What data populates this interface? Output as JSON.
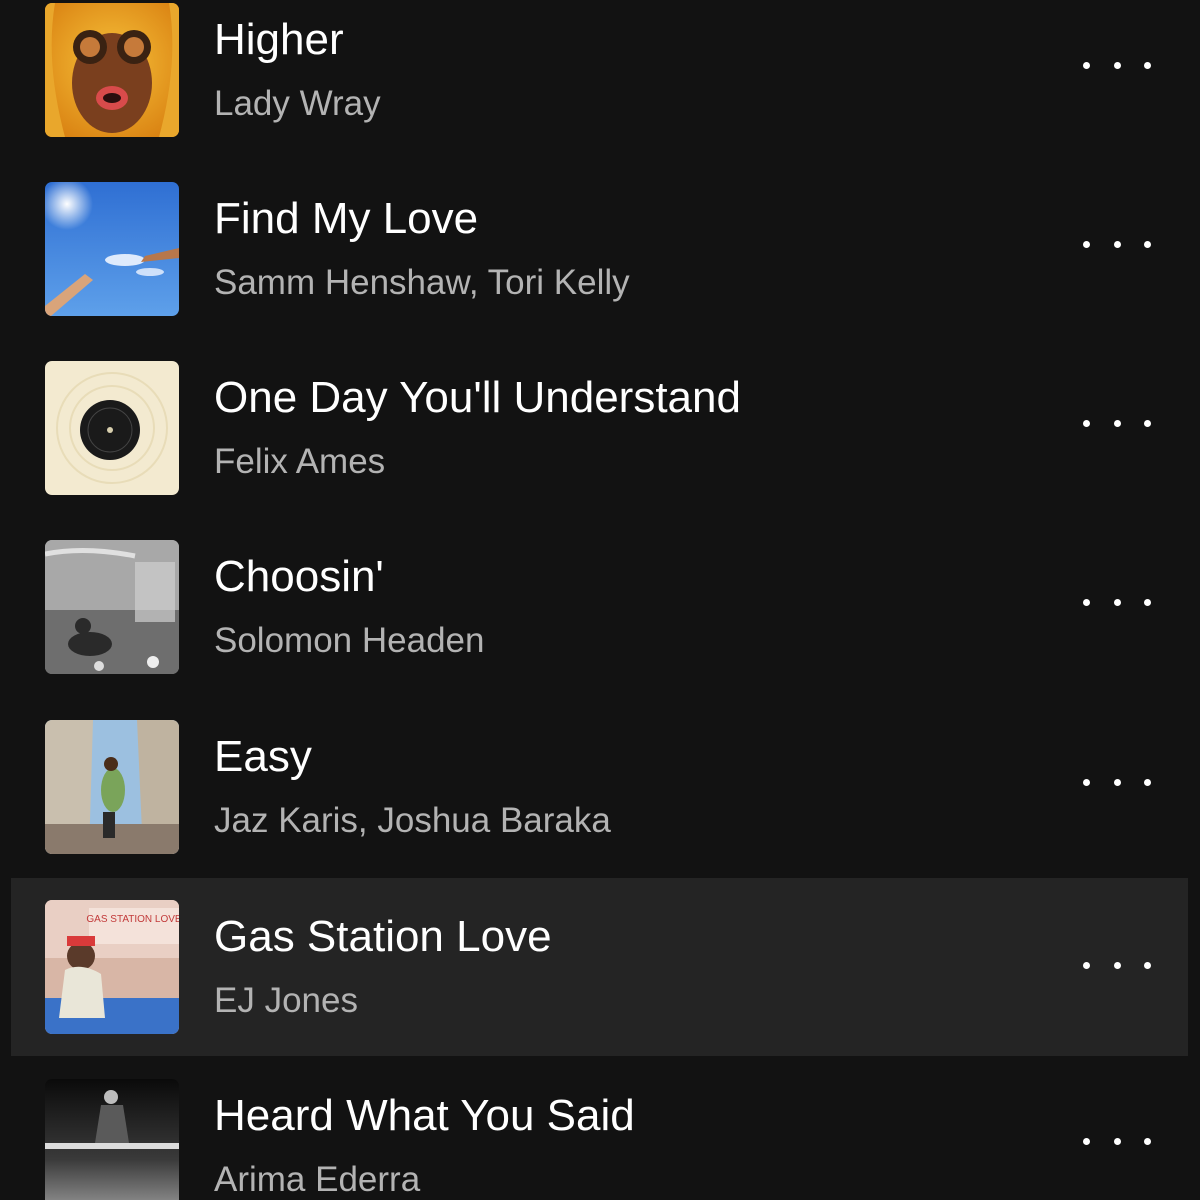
{
  "tracks": [
    {
      "title": "Higher",
      "artist": "Lady Wray",
      "active": false,
      "art": "higher-cover"
    },
    {
      "title": "Find My Love",
      "artist": "Samm Henshaw, Tori Kelly",
      "active": false,
      "art": "find-my-love-cover"
    },
    {
      "title": "One Day You'll Understand",
      "artist": "Felix Ames",
      "active": false,
      "art": "one-day-cover"
    },
    {
      "title": "Choosin'",
      "artist": "Solomon Headen",
      "active": false,
      "art": "choosin-cover"
    },
    {
      "title": "Easy",
      "artist": "Jaz Karis, Joshua Baraka",
      "active": false,
      "art": "easy-cover"
    },
    {
      "title": "Gas Station Love",
      "artist": "EJ Jones",
      "active": true,
      "art": "gas-station-love-cover",
      "art_text": "GAS STATION LOVE"
    },
    {
      "title": "Heard What You Said",
      "artist": "Arima Ederra",
      "active": false,
      "art": "heard-what-you-said-cover"
    }
  ],
  "more_icon": "more-options-icon",
  "colors": {
    "background": "#121212",
    "active_row": "#242424",
    "title": "#ffffff",
    "artist": "#b3b3b3"
  }
}
